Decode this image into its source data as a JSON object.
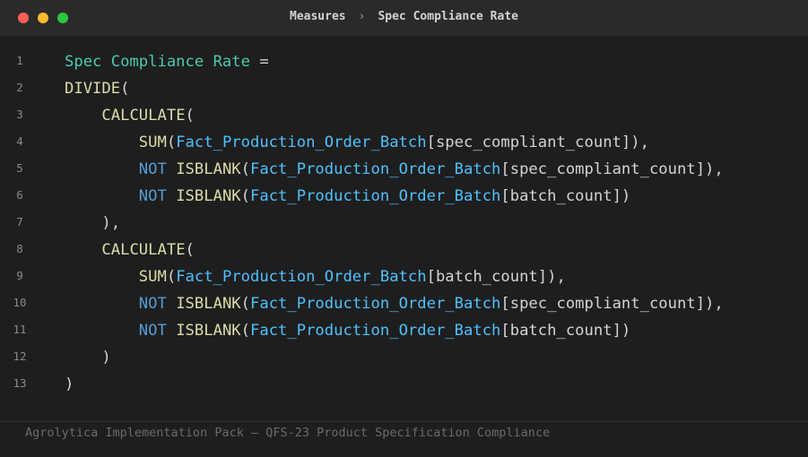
{
  "colors": {
    "window_bg": "#1e1e1e",
    "titlebar_bg": "#2a2a2a",
    "close": "#ff5f57",
    "minimize": "#febc2e",
    "zoom": "#28c840",
    "measure_name": "#4ec9b0",
    "function": "#dcdcaa",
    "keyword": "#569cd6",
    "table": "#4fc1ff",
    "column": "#d4d4d4",
    "punctuation": "#d4d4d4"
  },
  "window": {
    "breadcrumb_parent": "Measures",
    "breadcrumb_separator": "›",
    "breadcrumb_current": "Spec Compliance Rate"
  },
  "editor": {
    "lines": [
      {
        "num": "1",
        "tokens": [
          {
            "t": "Spec Compliance Rate",
            "k": "measure_name"
          },
          {
            "t": " =",
            "k": "punctuation"
          }
        ]
      },
      {
        "num": "2",
        "tokens": [
          {
            "t": "DIVIDE",
            "k": "function"
          },
          {
            "t": "(",
            "k": "punctuation"
          }
        ]
      },
      {
        "num": "3",
        "tokens": [
          {
            "t": "    ",
            "k": "punctuation"
          },
          {
            "t": "CALCULATE",
            "k": "function"
          },
          {
            "t": "(",
            "k": "punctuation"
          }
        ]
      },
      {
        "num": "4",
        "tokens": [
          {
            "t": "        ",
            "k": "punctuation"
          },
          {
            "t": "SUM",
            "k": "function"
          },
          {
            "t": "(",
            "k": "punctuation"
          },
          {
            "t": "Fact_Production_Order_Batch",
            "k": "table"
          },
          {
            "t": "[spec_compliant_count]",
            "k": "column"
          },
          {
            "t": "),",
            "k": "punctuation"
          }
        ]
      },
      {
        "num": "5",
        "tokens": [
          {
            "t": "        ",
            "k": "punctuation"
          },
          {
            "t": "NOT",
            "k": "keyword"
          },
          {
            "t": " ",
            "k": "punctuation"
          },
          {
            "t": "ISBLANK",
            "k": "function"
          },
          {
            "t": "(",
            "k": "punctuation"
          },
          {
            "t": "Fact_Production_Order_Batch",
            "k": "table"
          },
          {
            "t": "[spec_compliant_count]",
            "k": "column"
          },
          {
            "t": "),",
            "k": "punctuation"
          }
        ]
      },
      {
        "num": "6",
        "tokens": [
          {
            "t": "        ",
            "k": "punctuation"
          },
          {
            "t": "NOT",
            "k": "keyword"
          },
          {
            "t": " ",
            "k": "punctuation"
          },
          {
            "t": "ISBLANK",
            "k": "function"
          },
          {
            "t": "(",
            "k": "punctuation"
          },
          {
            "t": "Fact_Production_Order_Batch",
            "k": "table"
          },
          {
            "t": "[batch_count]",
            "k": "column"
          },
          {
            "t": ")",
            "k": "punctuation"
          }
        ]
      },
      {
        "num": "7",
        "tokens": [
          {
            "t": "    ",
            "k": "punctuation"
          },
          {
            "t": "),",
            "k": "punctuation"
          }
        ]
      },
      {
        "num": "8",
        "tokens": [
          {
            "t": "    ",
            "k": "punctuation"
          },
          {
            "t": "CALCULATE",
            "k": "function"
          },
          {
            "t": "(",
            "k": "punctuation"
          }
        ]
      },
      {
        "num": "9",
        "tokens": [
          {
            "t": "        ",
            "k": "punctuation"
          },
          {
            "t": "SUM",
            "k": "function"
          },
          {
            "t": "(",
            "k": "punctuation"
          },
          {
            "t": "Fact_Production_Order_Batch",
            "k": "table"
          },
          {
            "t": "[batch_count]",
            "k": "column"
          },
          {
            "t": "),",
            "k": "punctuation"
          }
        ]
      },
      {
        "num": "10",
        "tokens": [
          {
            "t": "        ",
            "k": "punctuation"
          },
          {
            "t": "NOT",
            "k": "keyword"
          },
          {
            "t": " ",
            "k": "punctuation"
          },
          {
            "t": "ISBLANK",
            "k": "function"
          },
          {
            "t": "(",
            "k": "punctuation"
          },
          {
            "t": "Fact_Production_Order_Batch",
            "k": "table"
          },
          {
            "t": "[spec_compliant_count]",
            "k": "column"
          },
          {
            "t": "),",
            "k": "punctuation"
          }
        ]
      },
      {
        "num": "11",
        "tokens": [
          {
            "t": "        ",
            "k": "punctuation"
          },
          {
            "t": "NOT",
            "k": "keyword"
          },
          {
            "t": " ",
            "k": "punctuation"
          },
          {
            "t": "ISBLANK",
            "k": "function"
          },
          {
            "t": "(",
            "k": "punctuation"
          },
          {
            "t": "Fact_Production_Order_Batch",
            "k": "table"
          },
          {
            "t": "[batch_count]",
            "k": "column"
          },
          {
            "t": ")",
            "k": "punctuation"
          }
        ]
      },
      {
        "num": "12",
        "tokens": [
          {
            "t": "    ",
            "k": "punctuation"
          },
          {
            "t": ")",
            "k": "punctuation"
          }
        ]
      },
      {
        "num": "13",
        "tokens": [
          {
            "t": ")",
            "k": "punctuation"
          }
        ]
      }
    ]
  },
  "footer": {
    "text": "Agrolytica Implementation Pack — QFS-23 Product Specification Compliance"
  }
}
